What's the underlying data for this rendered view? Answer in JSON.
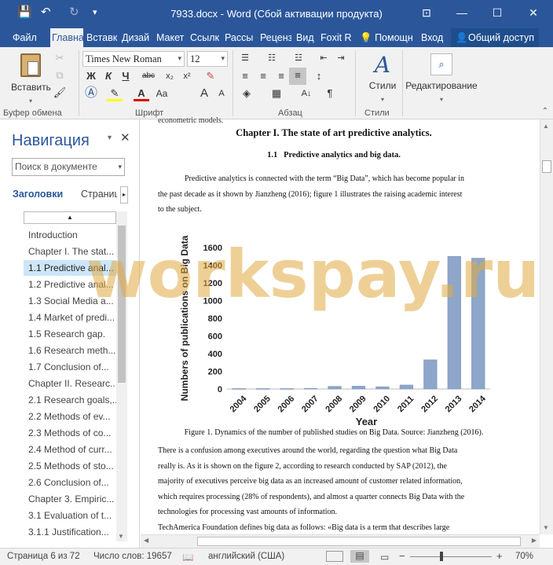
{
  "window": {
    "title": "7933.docx - Word (Сбой активации продукта)",
    "controls": {
      "ribbon_opts": "⊡",
      "minimize": "—",
      "maximize": "☐",
      "close": "✕"
    }
  },
  "quick_access": {
    "save": "💾",
    "undo": "↶",
    "redo": "↻",
    "customize": "▾"
  },
  "tabs": {
    "file": "Файл",
    "home": "Главна",
    "insert": "Вставк",
    "design": "Дизай",
    "layout": "Макет",
    "refs": "Ссылк",
    "mail": "Рассы",
    "review": "Реценз",
    "view": "Вид",
    "foxit": "Foxit R",
    "tell": "Помощн",
    "signin": "Вход",
    "share": "Общий доступ"
  },
  "ribbon": {
    "paste_label": "Вставить",
    "clipboard_label": "Буфер обмена",
    "font_label": "Шрифт",
    "paragraph_label": "Абзац",
    "styles_label": "Стили",
    "styles_btn": "Стили",
    "editing_btn": "Редактирование",
    "font_name": "Times New Roman",
    "font_size": "12",
    "bold": "Ж",
    "italic": "К",
    "underline": "Ч",
    "strike": "abc",
    "subscript": "x₂",
    "superscript": "x²",
    "grow": "A",
    "shrink": "A",
    "aa": "Aa",
    "pilcrow": "¶"
  },
  "navigation": {
    "title": "Навигация",
    "search_placeholder": "Поиск в документе",
    "tab_headings": "Заголовки",
    "tab_pages": "Страниц",
    "headings": [
      "Introduction",
      "Chapter I. The stat...",
      "1.1 Predictive anal...",
      "1.2 Predictive anal...",
      "1.3 Social Media a...",
      "1.4 Market of predi...",
      "1.5 Research gap.",
      "1.6 Research meth...",
      "1.7 Conclusion of...",
      "Chapter II. Researc...",
      "2.1 Research goals,...",
      "2.2 Methods of ev...",
      "2.3 Methods of co...",
      "2.4 Method of curr...",
      "2.5 Methods of sto...",
      "2.6 Conclusion of...",
      "Chapter 3. Empiric...",
      "3.1 Evaluation of t...",
      "3.1.1 Justification..."
    ],
    "selected_index": 2
  },
  "document": {
    "top_fragment": "econometric models.",
    "chapter_title": "Chapter I. The state of art predictive analytics.",
    "section_title": "1.1   Predictive analytics and big data.",
    "para1_lines": [
      "Predictive analytics is connected with the term “Big Data”, which has become popular in",
      "the past decade as it shown by Jianzheng (2016); figure 1 illustrates the raising academic interest",
      "to the subject."
    ],
    "figure_caption": "Figure 1. Dynamics of the number of published studies on Big Data. Source: Jianzheng (2016).",
    "para2_lines": [
      "There is a confusion among executives around the world, regarding the question what Big Data",
      "really is. As it is shown on the figure 2, according to research conducted by SAP (2012), the",
      "majority of executives perceive big data as an increased amount of customer related information,",
      "which requires processing (28% of respondents), and almost a quarter connects Big Data with the",
      "technologies for processing vast amounts of information.",
      "TechAmerica Foundation defines big data as follows: «Big data is a term that describes large"
    ]
  },
  "chart_data": {
    "type": "bar",
    "categories": [
      "2004",
      "2005",
      "2006",
      "2007",
      "2008",
      "2009",
      "2010",
      "2011",
      "2012",
      "2013",
      "2014"
    ],
    "values": [
      5,
      5,
      5,
      8,
      30,
      32,
      25,
      45,
      330,
      1500,
      1480
    ],
    "xlabel": "Year",
    "ylabel": "Numbers of publications on Big Data",
    "ylim": [
      0,
      1600
    ],
    "yticks": [
      0,
      200,
      400,
      600,
      800,
      1000,
      1200,
      1400,
      1600
    ],
    "bar_color": "#8da6c9",
    "grid": false
  },
  "watermark": "workspay.ru",
  "status": {
    "page": "Страница 6 из 72",
    "words": "Число слов: 19657",
    "language": "английский (США)",
    "zoom": "70%",
    "zoom_minus": "−",
    "zoom_plus": "+"
  },
  "colors": {
    "accent": "#2b579a",
    "selection": "#cde6f7"
  }
}
